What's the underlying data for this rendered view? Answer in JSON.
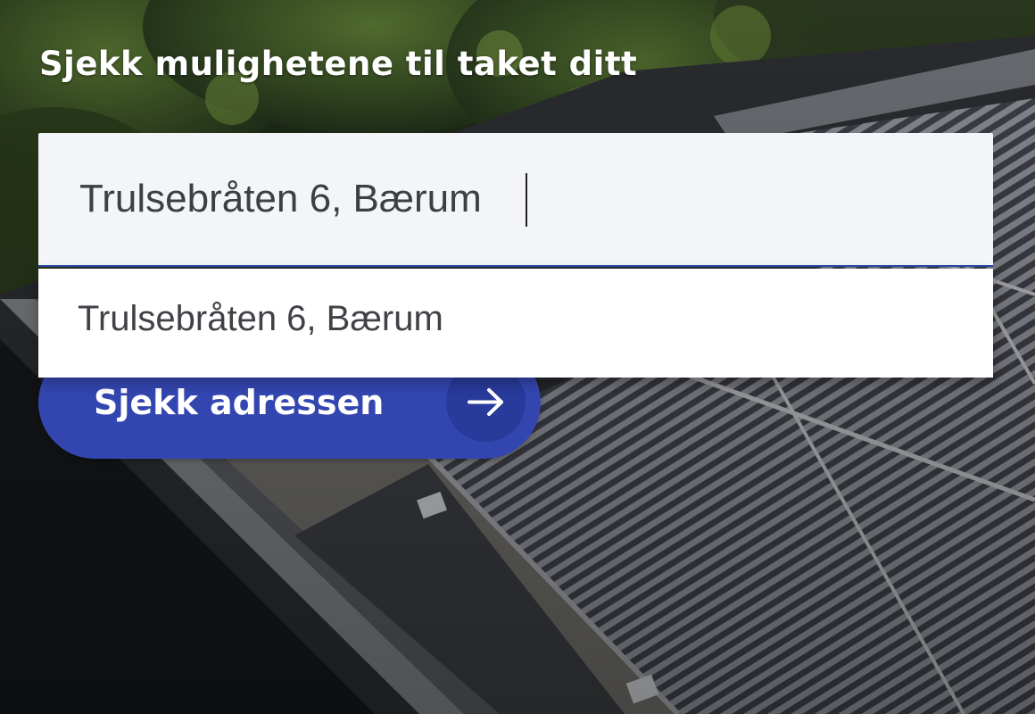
{
  "form": {
    "heading": "Sjekk mulighetene til taket ditt",
    "address_input": {
      "value": "Trulsebråten 6, Bærum"
    },
    "suggestions": [
      {
        "label": "Trulsebråten 6, Bærum"
      }
    ],
    "submit_button": {
      "label": "Sjekk adressen",
      "icon": "arrow-right-icon"
    }
  },
  "colors": {
    "button": "#3346b0",
    "button_icon_circle": "#283a9a",
    "input_background": "#f3f5f8",
    "input_focus_border": "#2c47a6",
    "heading_text": "#ffffff"
  }
}
